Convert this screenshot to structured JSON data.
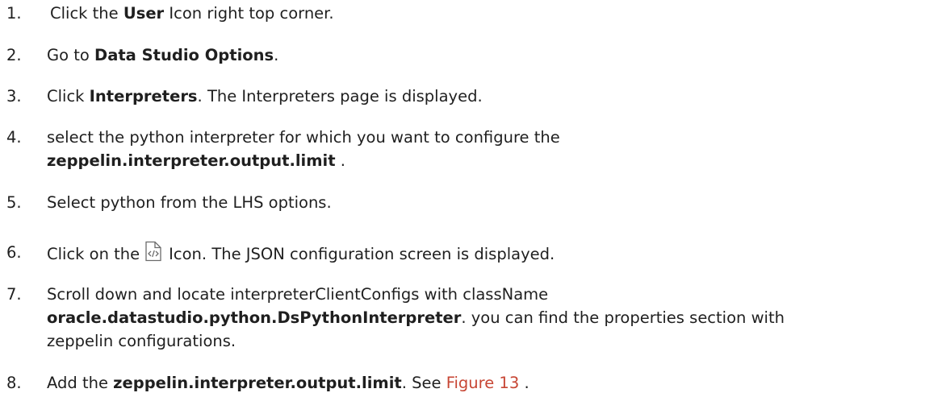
{
  "steps": [
    {
      "number": "1.",
      "parts": [
        "Click the ",
        "User",
        " Icon right top corner."
      ]
    },
    {
      "number": "2.",
      "parts": [
        "Go to ",
        "Data Studio Options",
        "."
      ]
    },
    {
      "number": "3.",
      "parts": [
        "Click ",
        "Interpreters",
        ". The Interpreters page is displayed."
      ]
    },
    {
      "number": "4.",
      "parts": [
        "select the python interpreter for which you want to configure the",
        "zeppelin.interpreter.output.limit",
        " ."
      ]
    },
    {
      "number": "5.",
      "parts": [
        "Select python from the LHS options."
      ]
    },
    {
      "number": "6.",
      "parts": [
        "Click on the",
        "Icon. The JSON configuration screen is displayed."
      ],
      "icon": "json-config-file-icon"
    },
    {
      "number": "7.",
      "parts": [
        "Scroll down and locate interpreterClientConfigs with className",
        "oracle.datastudio.python.DsPythonInterpreter",
        ". you can find the properties section with",
        "zeppelin configurations."
      ]
    },
    {
      "number": "8.",
      "parts": [
        "Add the ",
        "zeppelin.interpreter.output.limit",
        ". See ",
        "Figure 13",
        " ."
      ]
    }
  ],
  "colors": {
    "text": "#1f1f1f",
    "link": "#c74634"
  }
}
